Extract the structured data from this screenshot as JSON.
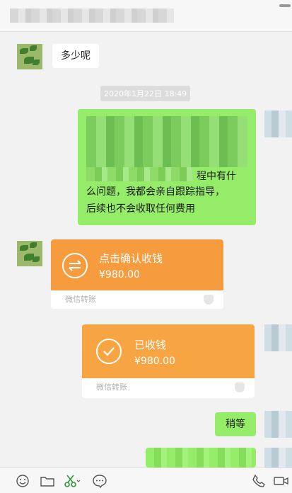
{
  "messages": {
    "incoming_text": "多少呢",
    "timestamp": "2020年1月22日 18:49",
    "outgoing_text_partial_line1": "程中有什",
    "outgoing_text_partial_line2": "么问题，我都会亲自跟踪指导，",
    "outgoing_text_partial_line3": "后续也不会收取任何费用",
    "outgoing_wait": "稍等"
  },
  "transfer_pending": {
    "title": "点击确认收钱",
    "amount": "¥980.00",
    "footer": "微信转账"
  },
  "transfer_received": {
    "title": "已收钱",
    "amount": "¥980.00",
    "footer": "微信转账"
  },
  "toolbar": {
    "icons": [
      "emoji-icon",
      "folder-icon",
      "scissors-icon",
      "chat-bubble-icon",
      "phone-icon",
      "video-icon"
    ]
  },
  "colors": {
    "accent_green": "#95ec69",
    "transfer_orange": "#f79c3e",
    "chat_bg": "#f2f2f2"
  }
}
